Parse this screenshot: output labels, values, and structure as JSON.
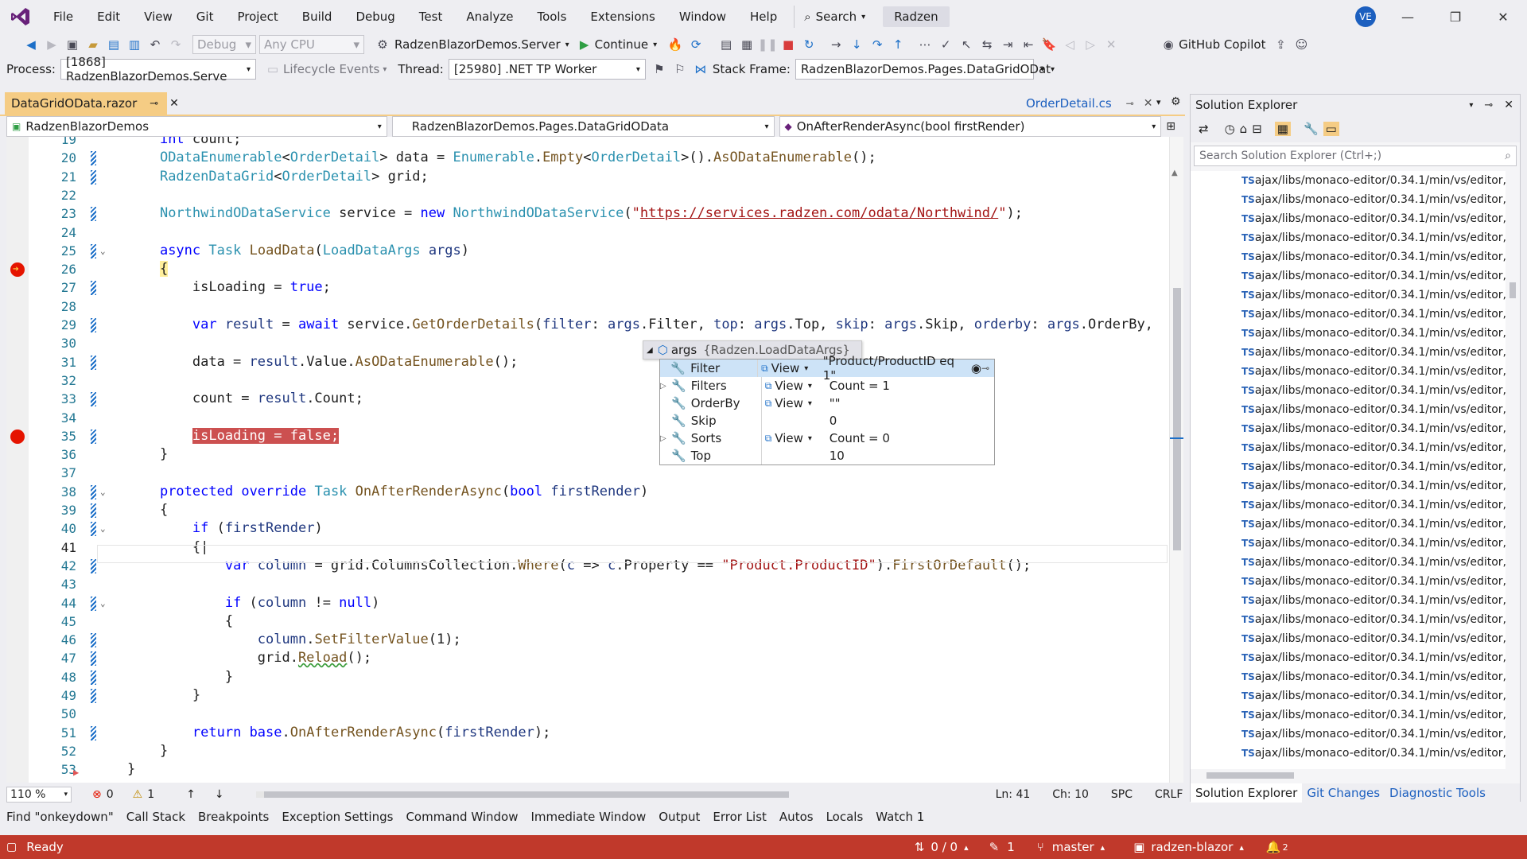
{
  "menu": [
    "File",
    "Edit",
    "View",
    "Git",
    "Project",
    "Build",
    "Debug",
    "Test",
    "Analyze",
    "Tools",
    "Extensions",
    "Window",
    "Help"
  ],
  "search_label": "Search",
  "radzen_label": "Radzen",
  "avatar_initials": "VE",
  "toolbar": {
    "config": "Debug",
    "platform": "Any CPU",
    "startup_project": "RadzenBlazorDemos.Server",
    "continue_label": "Continue",
    "copilot_label": "GitHub Copilot"
  },
  "debug_location": {
    "process_label": "Process:",
    "process_value": "[1868] RadzenBlazorDemos.Serve",
    "lifecycle_label": "Lifecycle Events",
    "thread_label": "Thread:",
    "thread_value": "[25980] .NET TP Worker",
    "stack_label": "Stack Frame:",
    "stack_value": "RadzenBlazorDemos.Pages.DataGridODat"
  },
  "doc_tabs": {
    "active": "DataGridOData.razor",
    "preview": "OrderDetail.cs"
  },
  "nav": {
    "project": "RadzenBlazorDemos",
    "type": "RadzenBlazorDemos.Pages.DataGridOData",
    "member": "OnAfterRenderAsync(bool firstRender)"
  },
  "code_lines": [
    {
      "n": "19",
      "html": "    <span class='kw'>int</span> count;"
    },
    {
      "n": "20",
      "html": "    <span class='ty'>ODataEnumerable</span>&lt;<span class='ty'>OrderDetail</span>&gt; data = <span class='ty'>Enumerable</span>.<span class='mt'>Empty</span>&lt;<span class='ty'>OrderDetail</span>&gt;().<span class='mt'>AsODataEnumerable</span>();"
    },
    {
      "n": "21",
      "html": "    <span class='ty'>RadzenDataGrid</span>&lt;<span class='ty'>OrderDetail</span>&gt; grid;"
    },
    {
      "n": "22",
      "html": ""
    },
    {
      "n": "23",
      "html": "    <span class='ty'>NorthwindODataService</span> service = <span class='kw'>new</span> <span class='ty'>NorthwindODataService</span>(<span class='str'>\"</span><span class='lnk'>https://services.radzen.com/odata/Northwind/</span><span class='str'>\"</span>);"
    },
    {
      "n": "24",
      "html": ""
    },
    {
      "n": "25",
      "html": "    <span class='kw'>async</span> <span class='ty'>Task</span> <span class='mt'>LoadData</span>(<span class='ty'>LoadDataArgs</span> <span class='pr'>args</span>)"
    },
    {
      "n": "26",
      "html": "    <span style='background:#ffef9c'>{</span>"
    },
    {
      "n": "27",
      "html": "        isLoading = <span class='kw'>true</span>;"
    },
    {
      "n": "28",
      "html": ""
    },
    {
      "n": "29",
      "html": "        <span class='kw'>var</span> <span class='pr'>result</span> = <span class='kw'>await</span> service.<span class='mt'>GetOrderDetails</span>(<span class='pr'>filter</span>: <span class='pr'>args</span>.Filter, <span class='pr'>top</span>: <span class='pr'>args</span>.Top, <span class='pr'>skip</span>: <span class='pr'>args</span>.Skip, <span class='pr'>orderby</span>: <span class='pr'>args</span>.OrderBy,"
    },
    {
      "n": "30",
      "html": ""
    },
    {
      "n": "31",
      "html": "        data = <span class='pr'>result</span>.Value.<span class='mt'>AsODataEnumerable</span>();"
    },
    {
      "n": "32",
      "html": ""
    },
    {
      "n": "33",
      "html": "        count = <span class='pr'>result</span>.Count;"
    },
    {
      "n": "34",
      "html": ""
    },
    {
      "n": "35",
      "html": "        <span class='hl'>isLoading = false;</span>"
    },
    {
      "n": "36",
      "html": "    }"
    },
    {
      "n": "37",
      "html": ""
    },
    {
      "n": "38",
      "html": "    <span class='kw'>protected</span> <span class='kw'>override</span> <span class='ty'>Task</span> <span class='mt'>OnAfterRenderAsync</span>(<span class='kw'>bool</span> <span class='pr'>firstRender</span>)"
    },
    {
      "n": "39",
      "html": "    {"
    },
    {
      "n": "40",
      "html": "        <span class='kw'>if</span> (<span class='pr'>firstRender</span>)"
    },
    {
      "n": "41",
      "html": "        {|"
    },
    {
      "n": "42",
      "html": "            <span class='kw'>var</span> <span class='pr'>column</span> = grid.ColumnsCollection.<span class='mt'>Where</span>(<span class='pr'>c</span> =&gt; <span class='pr'>c</span>.Property == <span class='str'>\"Product.ProductID\"</span>).<span class='mt'>FirstOrDefault</span>();"
    },
    {
      "n": "43",
      "html": ""
    },
    {
      "n": "44",
      "html": "            <span class='kw'>if</span> (<span class='pr'>column</span> != <span class='kw'>null</span>)"
    },
    {
      "n": "45",
      "html": "            {"
    },
    {
      "n": "46",
      "html": "                <span class='pr'>column</span>.<span class='mt'>SetFilterValue</span>(1);"
    },
    {
      "n": "47",
      "html": "                grid.<span class='mt' style='text-decoration:underline wavy #3a9c3a'>Reload</span>();"
    },
    {
      "n": "48",
      "html": "            }"
    },
    {
      "n": "49",
      "html": "        }"
    },
    {
      "n": "50",
      "html": ""
    },
    {
      "n": "51",
      "html": "        <span class='kw'>return</span> <span class='kw'>base</span>.<span class='mt'>OnAfterRenderAsync</span>(<span class='pr'>firstRender</span>);"
    },
    {
      "n": "52",
      "html": "    }"
    },
    {
      "n": "53",
      "html": "}"
    }
  ],
  "datatip": {
    "header_name": "args",
    "header_value": "{Radzen.LoadDataArgs}",
    "rows": [
      {
        "name": "Filter",
        "view": "View",
        "value": "\"Product/ProductID eq 1\"",
        "expand": ""
      },
      {
        "name": "Filters",
        "view": "View",
        "value": "Count = 1",
        "expand": "▷"
      },
      {
        "name": "OrderBy",
        "view": "View",
        "value": "\"\"",
        "expand": ""
      },
      {
        "name": "Skip",
        "view": "",
        "value": "0",
        "expand": ""
      },
      {
        "name": "Sorts",
        "view": "View",
        "value": "Count = 0",
        "expand": "▷"
      },
      {
        "name": "Top",
        "view": "",
        "value": "10",
        "expand": ""
      }
    ]
  },
  "editor_status": {
    "zoom": "110 %",
    "errors": "0",
    "warnings": "1",
    "ln": "Ln: 41",
    "ch": "Ch: 10",
    "spc": "SPC",
    "crlf": "CRLF"
  },
  "bottom_tabs": [
    "Find \"onkeydown\"",
    "Call Stack",
    "Breakpoints",
    "Exception Settings",
    "Command Window",
    "Immediate Window",
    "Output",
    "Error List",
    "Autos",
    "Locals",
    "Watch 1"
  ],
  "status": {
    "ready": "Ready",
    "changes": "0 / 0",
    "edits": "1",
    "branch": "master",
    "repo": "radzen-blazor",
    "notifications": "2"
  },
  "solution_explorer": {
    "title": "Solution Explorer",
    "search_placeholder": "Search Solution Explorer (Ctrl+;)",
    "item_label": "ajax/libs/monaco-editor/0.34.1/min/vs/editor,",
    "item_count": 31,
    "tabs": [
      "Solution Explorer",
      "Git Changes",
      "Diagnostic Tools"
    ]
  },
  "colors": {
    "accent": "#68217a",
    "tab_active": "#f5cc84",
    "status": "#c0392b",
    "breakpoint": "#e51400"
  }
}
